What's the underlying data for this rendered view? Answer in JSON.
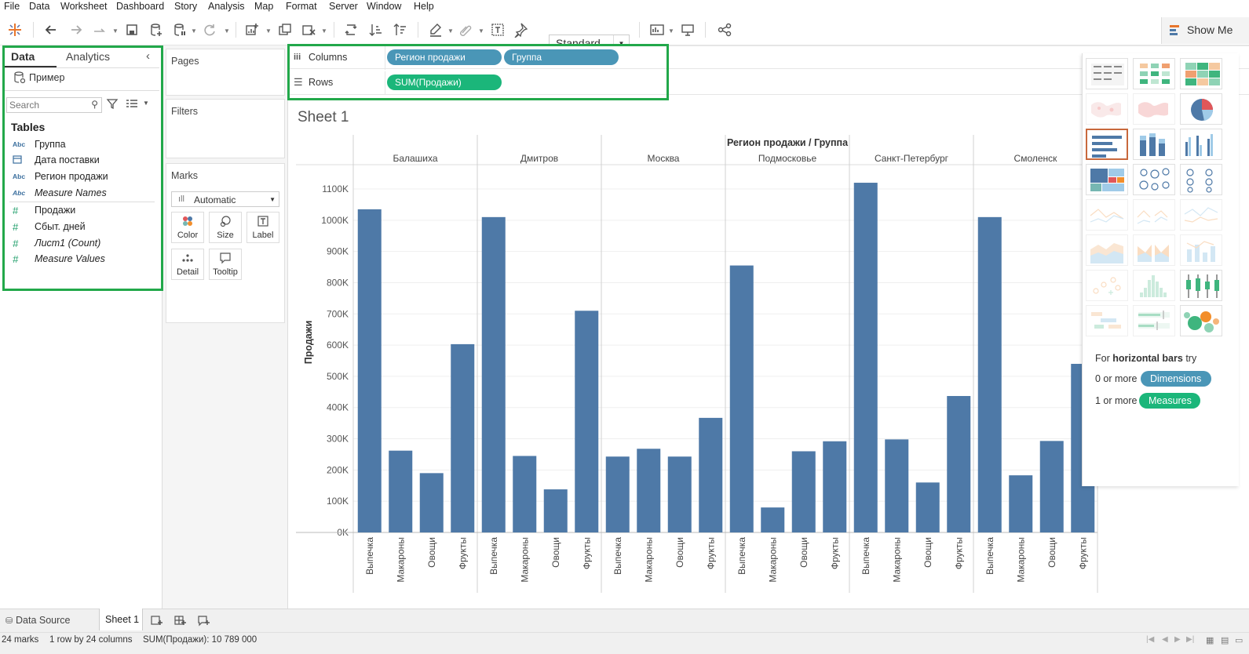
{
  "menu": [
    "File",
    "Data",
    "Worksheet",
    "Dashboard",
    "Story",
    "Analysis",
    "Map",
    "Format",
    "Server",
    "Window",
    "Help"
  ],
  "toolbar": {
    "fit_value": "Standard",
    "show_me_label": "Show Me"
  },
  "data_pane": {
    "tab_data": "Data",
    "tab_analytics": "Analytics",
    "datasource": "Пример",
    "search_placeholder": "Search",
    "tables_heading": "Tables",
    "dimensions": [
      {
        "type": "Abc",
        "name": "Группа"
      },
      {
        "type": "date",
        "name": "Дата поставки"
      },
      {
        "type": "Abc",
        "name": "Регион продажи"
      },
      {
        "type": "Abc",
        "name": "Measure Names"
      }
    ],
    "measures": [
      {
        "type": "#",
        "name": "Продажи"
      },
      {
        "type": "#",
        "name": "Сбыт. дней"
      },
      {
        "type": "#",
        "name": "Лист1 (Count)"
      },
      {
        "type": "#",
        "name": "Measure Values"
      }
    ]
  },
  "cards": {
    "pages": "Pages",
    "filters": "Filters",
    "marks": "Marks",
    "mark_type": "Automatic",
    "buttons": [
      "Color",
      "Size",
      "Label",
      "Detail",
      "Tooltip"
    ]
  },
  "shelves": {
    "columns_label": "Columns",
    "rows_label": "Rows",
    "columns_pills": [
      "Регион продажи",
      "Группа"
    ],
    "rows_pills": [
      "SUM(Продажи)"
    ]
  },
  "sheet_title": "Sheet 1",
  "colors": {
    "bar": "#4e79a7",
    "dimension_pill": "#4a96b7",
    "measure_pill": "#1bb67a",
    "highlight_box": "#22a84a"
  },
  "chart_data": {
    "type": "bar",
    "header_title": "Регион продажи / Группа",
    "ylabel": "Продажи",
    "ylim": [
      0,
      1150000
    ],
    "yticks": [
      "0K",
      "100K",
      "200K",
      "300K",
      "400K",
      "500K",
      "600K",
      "700K",
      "800K",
      "900K",
      "1000K",
      "1100K"
    ],
    "ytick_values": [
      0,
      100000,
      200000,
      300000,
      400000,
      500000,
      600000,
      700000,
      800000,
      900000,
      1000000,
      1100000
    ],
    "groups": [
      "Балашиха",
      "Дмитров",
      "Москва",
      "Подмосковье",
      "Санкт-Петербург",
      "Смоленск"
    ],
    "categories": [
      "Выпечка",
      "Макароны",
      "Овощи",
      "Фрукты"
    ],
    "series": [
      {
        "group": "Балашиха",
        "values": [
          1035000,
          262000,
          190000,
          603000
        ]
      },
      {
        "group": "Дмитров",
        "values": [
          1010000,
          245000,
          138000,
          710000
        ]
      },
      {
        "group": "Москва",
        "values": [
          243000,
          268000,
          243000,
          367000
        ]
      },
      {
        "group": "Подмосковье",
        "values": [
          855000,
          80000,
          260000,
          292000
        ]
      },
      {
        "group": "Санкт-Петербург",
        "values": [
          1120000,
          298000,
          160000,
          437000
        ]
      },
      {
        "group": "Смоленск",
        "values": [
          1010000,
          183000,
          293000,
          540000
        ]
      }
    ]
  },
  "show_me": {
    "help_for": "For",
    "help_bold": "horizontal bars",
    "help_try": "try",
    "dim_prefix": "0 or more",
    "dim_pill": "Dimensions",
    "meas_prefix": "1 or more",
    "meas_pill": "Measures",
    "thumbs": [
      "text-table",
      "highlight-table",
      "heat-map",
      "symbol-map",
      "filled-map",
      "pie-chart",
      "horizontal-bars",
      "stacked-bars",
      "side-by-side-bars",
      "treemap",
      "circle-views",
      "side-by-side-circles",
      "continuous-lines",
      "discrete-lines",
      "dual-lines",
      "area-continuous",
      "area-discrete",
      "dual-combination",
      "scatter-plot",
      "histogram",
      "box-whisker",
      "gantt",
      "bullet-graph",
      "packed-bubbles"
    ]
  },
  "tabs": {
    "data_source": "Data Source",
    "sheet": "Sheet 1"
  },
  "status": {
    "marks": "24 marks",
    "dims": "1 row by 24 columns",
    "sum": "SUM(Продажи): 10 789 000"
  }
}
